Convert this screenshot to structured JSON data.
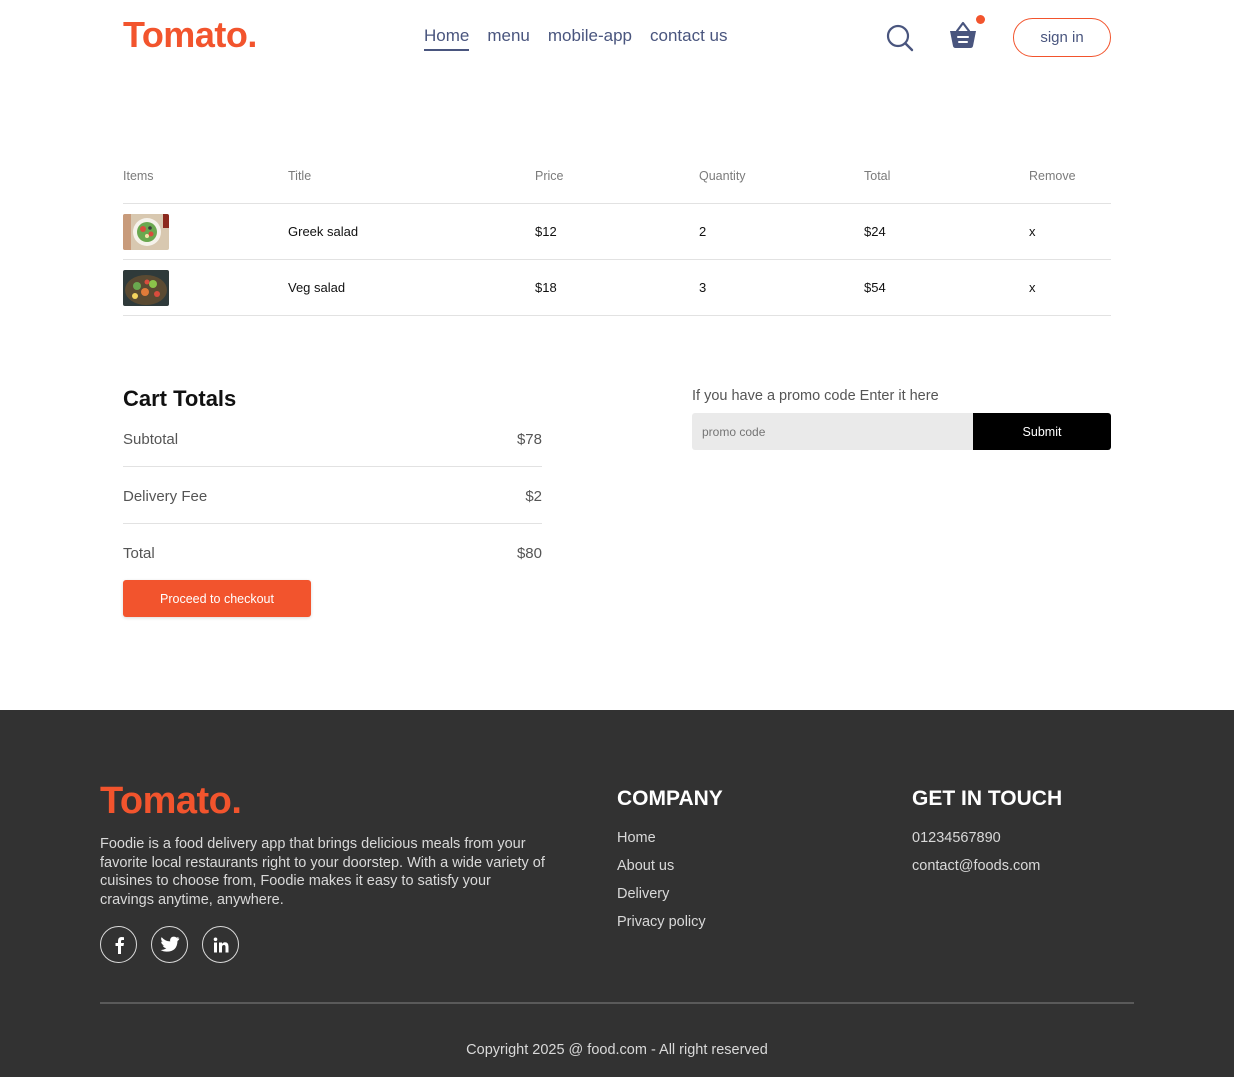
{
  "brand": {
    "logo": "Tomato.",
    "accent_color": "#f2542d",
    "nav_text_color": "#49557e"
  },
  "nav": {
    "items": [
      {
        "label": "Home",
        "active": true
      },
      {
        "label": "menu",
        "active": false
      },
      {
        "label": "mobile-app",
        "active": false
      },
      {
        "label": "contact us",
        "active": false
      }
    ],
    "search_icon": "search-icon",
    "basket_icon": "basket-icon",
    "signin_label": "sign in"
  },
  "cart": {
    "headers": [
      "Items",
      "Title",
      "Price",
      "Quantity",
      "Total",
      "Remove"
    ],
    "items": [
      {
        "image": "greek-salad-image",
        "title": "Greek salad",
        "price": "$12",
        "quantity": "2",
        "total": "$24",
        "remove": "x"
      },
      {
        "image": "veg-salad-image",
        "title": "Veg salad",
        "price": "$18",
        "quantity": "3",
        "total": "$54",
        "remove": "x"
      }
    ]
  },
  "totals": {
    "heading": "Cart Totals",
    "subtotal_label": "Subtotal",
    "subtotal_value": "$78",
    "delivery_label": "Delivery Fee",
    "delivery_value": "$2",
    "total_label": "Total",
    "total_value": "$80",
    "checkout_label": "Proceed to checkout"
  },
  "promo": {
    "label": "If you have a promo code Enter it here",
    "placeholder": "promo code",
    "submit_label": "Submit"
  },
  "footer": {
    "logo": "Tomato.",
    "description": "Foodie is a food delivery app that brings delicious meals from your favorite local restaurants right to your doorstep. With a wide variety of cuisines to choose from, Foodie makes it easy to satisfy your cravings anytime, anywhere.",
    "socials": [
      "facebook-icon",
      "twitter-icon",
      "linkedin-icon"
    ],
    "company_title": "COMPANY",
    "company_links": [
      "Home",
      "About us",
      "Delivery",
      "Privacy policy"
    ],
    "contact_title": "GET IN TOUCH",
    "contact_items": [
      "01234567890",
      "contact@foods.com"
    ],
    "copyright": "Copyright 2025 @ food.com - All right reserved"
  }
}
